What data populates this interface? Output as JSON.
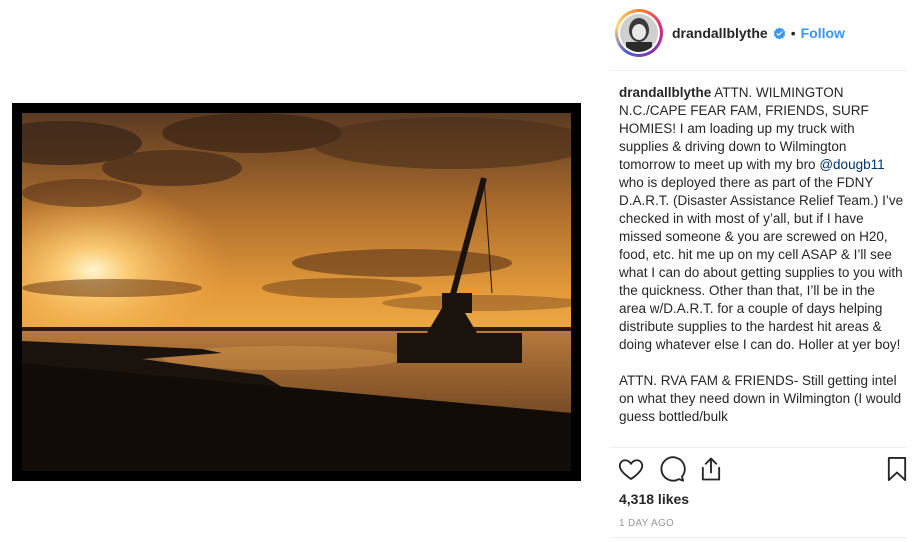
{
  "post": {
    "username": "drandallblythe",
    "separator": "•",
    "follow_label": "Follow",
    "caption": {
      "paragraph1_before": "ATTN. WILMINGTON N.C./CAPE FEAR FAM, FRIENDS, SURF HOMIES! I am loading up my truck with supplies & driving down to Wilmington tomorrow to meet up with my bro",
      "mention": "@dougb11",
      "paragraph1_after": "who is deployed there as part of the FDNY D.A.R.T. (Disaster Assistance Relief Team.) I’ve checked in with most of y’all, but if I have missed someone & you are screwed on H20, food, etc. hit me up on my cell ASAP & I’ll see what I can do about getting supplies to you with the quickness. Other than that, I’ll be in the area w/D.A.R.T. for a couple of days helping distribute supplies to the hardest hit areas & doing whatever else I can do. Holler at yer boy!",
      "paragraph2": "ATTN. RVA FAM & FRIENDS- Still getting intel on what they need down in Wilmington (I would guess bottled/bulk"
    },
    "likes": "4,318 likes",
    "timestamp": "1 DAY AGO"
  },
  "icons": {
    "like": "heart-icon",
    "comment": "comment-icon",
    "share": "share-icon",
    "save": "bookmark-icon",
    "verified": "verified-badge-icon"
  },
  "colors": {
    "follow": "#3897f0",
    "verified": "#3897f0",
    "mention": "#003569",
    "timestamp": "#999999"
  }
}
